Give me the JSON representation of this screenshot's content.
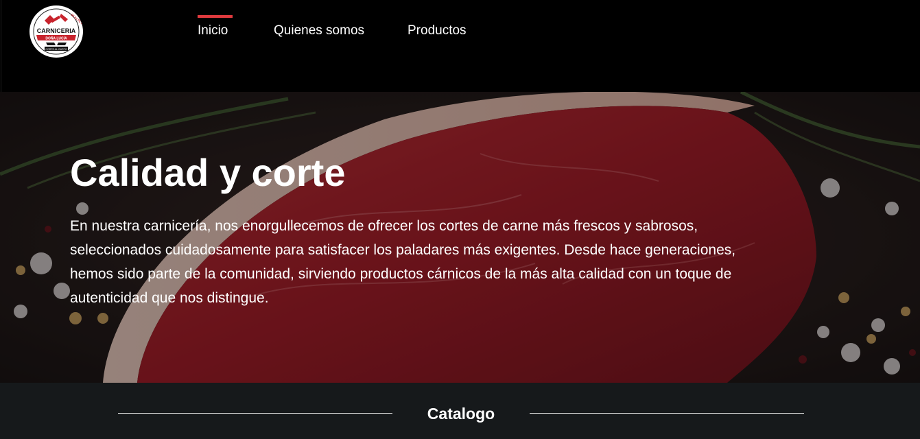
{
  "logo": {
    "brand": "CARNICERIA",
    "tagline": "CORTE AL GUSTO",
    "ribbon": "DOÑA LUCÍA",
    "phone": "55 21 05 8471"
  },
  "nav": {
    "items": [
      {
        "label": "Inicio",
        "active": true
      },
      {
        "label": "Quienes somos",
        "active": false
      },
      {
        "label": "Productos",
        "active": false
      }
    ],
    "accent_color": "#e03a3e"
  },
  "hero": {
    "title": "Calidad y corte",
    "text": "En nuestra carnicería, nos enorgullecemos de ofrecer los cortes de carne más frescos y sabrosos, seleccionados cuidadosamente para satisfacer los paladares más exigentes. Desde hace generaciones, hemos sido parte de la comunidad, sirviendo productos cárnicos de la más alta calidad con un toque de autenticidad que nos distingue."
  },
  "catalog": {
    "title": "Catalogo"
  }
}
